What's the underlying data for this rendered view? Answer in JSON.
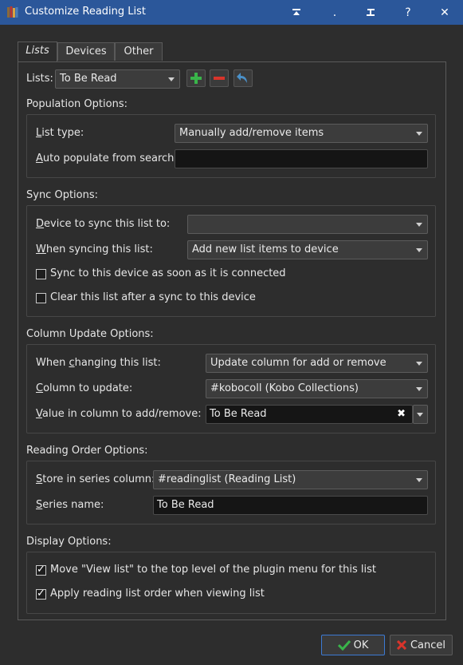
{
  "window": {
    "title": "Customize Reading List",
    "controls": {
      "pin": "═",
      "minimize": ".",
      "restore": "□",
      "help": "?",
      "close": "✕"
    }
  },
  "tabs": [
    "Lists",
    "Devices",
    "Other"
  ],
  "lists": {
    "label": "Lists:",
    "selected": "To Be Read"
  },
  "population": {
    "heading": "Population Options:",
    "list_type_label": "List type:",
    "list_type_value": "Manually add/remove items",
    "auto_populate_label": "Auto populate from search:",
    "auto_populate_value": ""
  },
  "sync": {
    "heading": "Sync Options:",
    "device_label": "Device to sync this list to:",
    "device_value": "",
    "when_label": "When syncing this list:",
    "when_value": "Add new list items to device",
    "chk_sync_connected": "Sync to this device as soon as it is connected",
    "chk_clear_after": "Clear this list after a sync to this device"
  },
  "column_update": {
    "heading": "Column Update Options:",
    "when_changing_label": "When changing this list:",
    "when_changing_value": "Update column for add or remove",
    "column_label": "Column to update:",
    "column_value": "#kobocoll (Kobo Collections)",
    "value_label": "Value in column to add/remove:",
    "value_value": "To Be Read"
  },
  "reading_order": {
    "heading": "Reading Order Options:",
    "store_label": "Store in series column:",
    "store_value": "#readinglist (Reading List)",
    "series_label": "Series name:",
    "series_value": "To Be Read"
  },
  "display": {
    "heading": "Display Options:",
    "chk_move_view": "Move \"View list\" to the top level of the plugin menu for this list",
    "chk_apply_order": "Apply reading list order when viewing list"
  },
  "buttons": {
    "ok": "OK",
    "cancel": "Cancel"
  },
  "colors": {
    "titlebar": "#2b579a",
    "add_green": "#39b54a",
    "remove_red": "#d9342b",
    "undo_blue": "#4a90c8"
  }
}
